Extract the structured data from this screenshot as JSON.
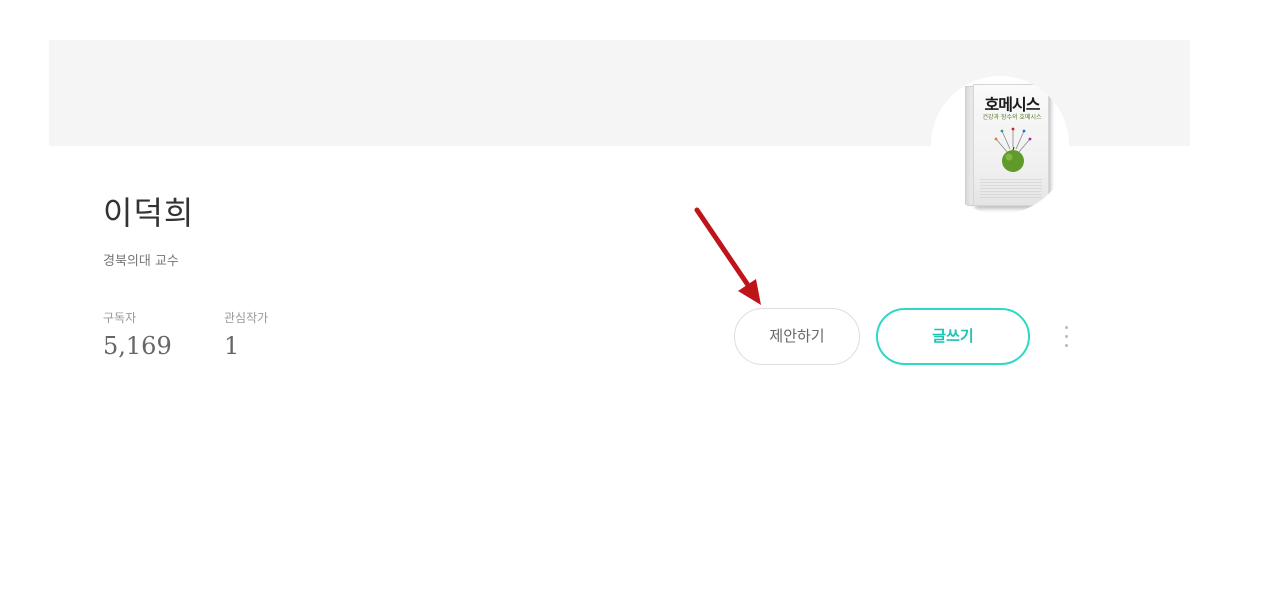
{
  "profile": {
    "name": "이덕희",
    "job": "경북의대 교수",
    "photo": {
      "book_title": "호메시스",
      "book_subtitle": "건강과 장수의 호메시스"
    }
  },
  "stats": {
    "subscribers_label": "구독자",
    "subscribers_value": "5,169",
    "following_label": "관심작가",
    "following_value": "1"
  },
  "actions": {
    "suggest_label": "제안하기",
    "write_label": "글쓰기",
    "more_icon": "vertical-ellipsis-icon"
  },
  "colors": {
    "accent": "#2dd8c6",
    "cover_background": "#f5f5f5",
    "annotation_arrow": "#c0141b"
  }
}
